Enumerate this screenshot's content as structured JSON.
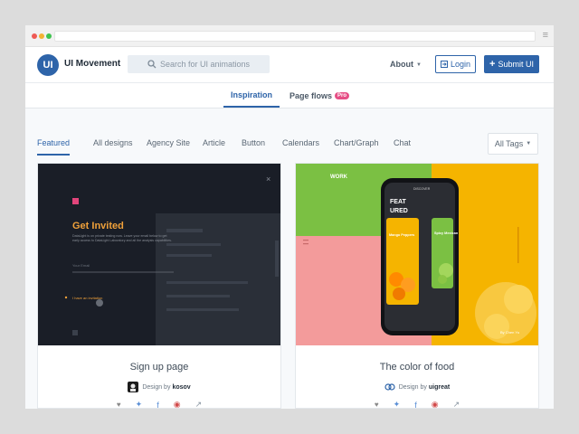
{
  "brand": {
    "name": "UI Movement",
    "logo_text": "UI"
  },
  "search": {
    "placeholder": "Search for UI animations"
  },
  "header": {
    "about": "About",
    "login": "Login",
    "submit": "Submit UI"
  },
  "subnav": {
    "inspiration": "Inspiration",
    "page_flows": "Page flows",
    "pro_badge": "Pro"
  },
  "categories": [
    "Featured",
    "All designs",
    "Agency Site",
    "Article",
    "Button",
    "Calendars",
    "Chart/Graph",
    "Chat"
  ],
  "all_tags": "All Tags",
  "cards": [
    {
      "title": "Sign up page",
      "design_by": "Design by",
      "author": "kosov",
      "preview": {
        "heading": "Get Invited",
        "body": "DataLight is on private testing now. Leave your email below to get early access to DataLight Laboratory and all the analysis capabilities.",
        "field": "Your Email",
        "link": "I have an invitation"
      }
    },
    {
      "title": "The color of food",
      "design_by": "Design by",
      "author": "uigreat",
      "preview": {
        "nav": "WORK",
        "phone_header": "DISCOVER",
        "phone_title_1": "FEAT",
        "phone_title_2": "URED",
        "card_1": "Mango Peppers",
        "card_2": "Spicy Mexican",
        "credit": "By Chen Yu"
      }
    }
  ],
  "colors": {
    "accent": "#2e64a9",
    "pro": "#e64f86",
    "food_green": "#7bc043",
    "food_yellow": "#f5b400",
    "food_pink": "#f39b9b"
  }
}
